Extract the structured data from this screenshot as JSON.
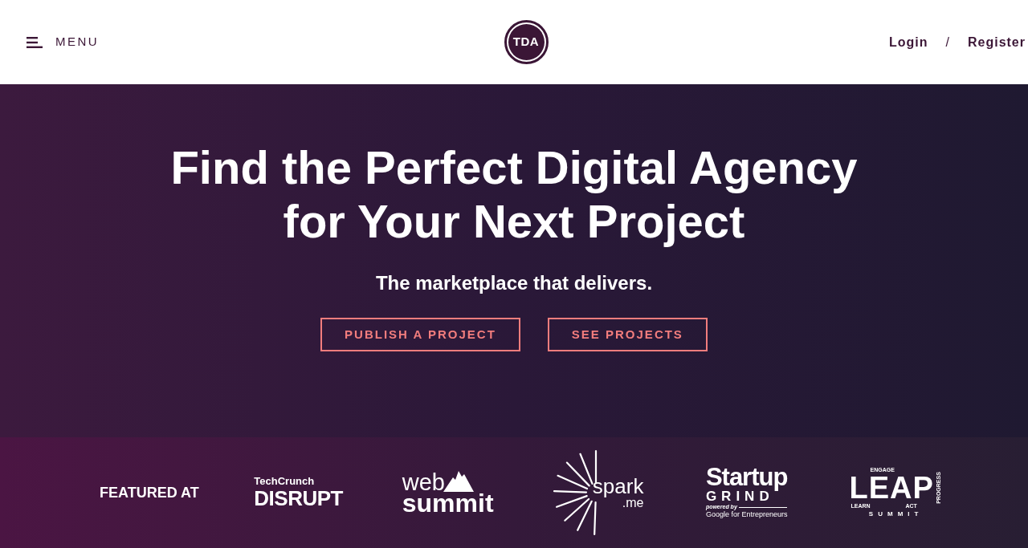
{
  "header": {
    "menu": {
      "label": "MENU"
    },
    "logo": {
      "text": "TDA"
    },
    "auth": {
      "login": "Login",
      "separator": "/",
      "register": "Register"
    }
  },
  "hero": {
    "title": "Find the Perfect Digital Agency for Your Next Project",
    "subtitle": "The marketplace that delivers.",
    "buttons": [
      {
        "label": "PUBLISH A PROJECT"
      },
      {
        "label": "SEE PROJECTS"
      }
    ]
  },
  "featured": {
    "label": "FEATURED AT",
    "logos": [
      {
        "kind": "techcrunch",
        "texts": [
          "TechCrunch",
          "DISRUPT"
        ]
      },
      {
        "kind": "websummit",
        "texts": [
          "web",
          "summit"
        ]
      },
      {
        "kind": "spark",
        "texts": [
          "spark",
          ".me"
        ]
      },
      {
        "kind": "startupgrind",
        "texts": [
          "Startup",
          "GRIND",
          "powered by",
          "Google for Entrepreneurs"
        ]
      },
      {
        "kind": "leap",
        "texts": [
          "ENGAGE",
          "LEAP",
          "PROGRESS",
          "LEARN",
          "ACT",
          "SUMMIT"
        ]
      }
    ]
  }
}
